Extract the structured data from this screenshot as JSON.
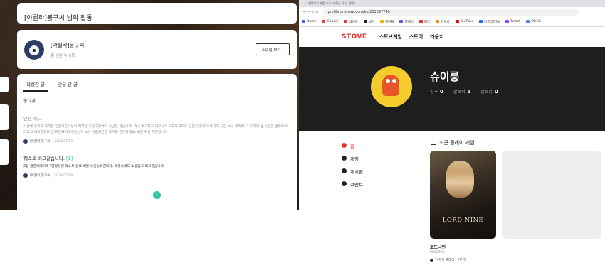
{
  "left": {
    "header_title": "[아퀼라]붕구씨 님의 활동",
    "profile": {
      "name": "[아퀼라]붕구씨",
      "visits": "총 방문 수 0회",
      "view_button": "프로필 보기"
    },
    "tabs": [
      "작성한 글",
      "댓글 단 글"
    ],
    "total": "총 2개",
    "posts": [
      {
        "title": "단전 버그",
        "count": "",
        "body": "사냥체 조기화 되지만 던전시간이상이 터져만 이걸 2층에서 사냥을 했습니다. 속시 초기화가 되고나서 0초가 되더도 던현가 들에 야욕까지 시간 보너 캐릭터 이 초기에 숲 시간만 연료로 되어있고 타이한외교인 36분표가데어있는거 보아 이걸시간은 초기와 된거같네요. 빠른 확인 부탁합니다.",
        "author": "[아퀼라]붕구씨",
        "date": "2024.07.19"
      },
      {
        "title": "퀘스트 버그같습니다.",
        "count": "[1]",
        "body": "2장 골란에데아에 \"영양불명 퀘스트 완료 버튼이 안눌리검리다. 패킷속에도 소용없고 버그같습니다.",
        "author": "[아퀼라]붕구씨",
        "date": "2024.07.18"
      }
    ],
    "page": "1"
  },
  "right": {
    "browser": {
      "url": "profile.onstove.com/ko/221697740",
      "tabs_text": "ㄴ 계정보기 제품나나  ·  바퀴구 ·주식 일반 :"
    },
    "bookmarks": [
      "Daum",
      "Google",
      "네이트",
      "넥슨",
      "넷마블",
      "엔게임",
      "피망",
      "한게임",
      "YouTube",
      "아프리카TV",
      "Twitch",
      "OP.GG"
    ],
    "nav": {
      "logo": "STOVE",
      "links": [
        "스토브게임",
        "스토어",
        "라운지"
      ]
    },
    "user": {
      "name": "슈이룽",
      "friends_label": "친구",
      "friends": "0",
      "followers_label": "팔로워",
      "followers": "1",
      "following_label": "팔로잉",
      "following": "0"
    },
    "menu": [
      "홈",
      "게임",
      "게시글",
      "코멘트"
    ],
    "recent_title": "최근 플레이 게임",
    "game": {
      "logo": "LORD NINE",
      "name": "로드나인",
      "genre": "MMORPG",
      "last": "마지막 플레이 : 7분 전"
    }
  }
}
